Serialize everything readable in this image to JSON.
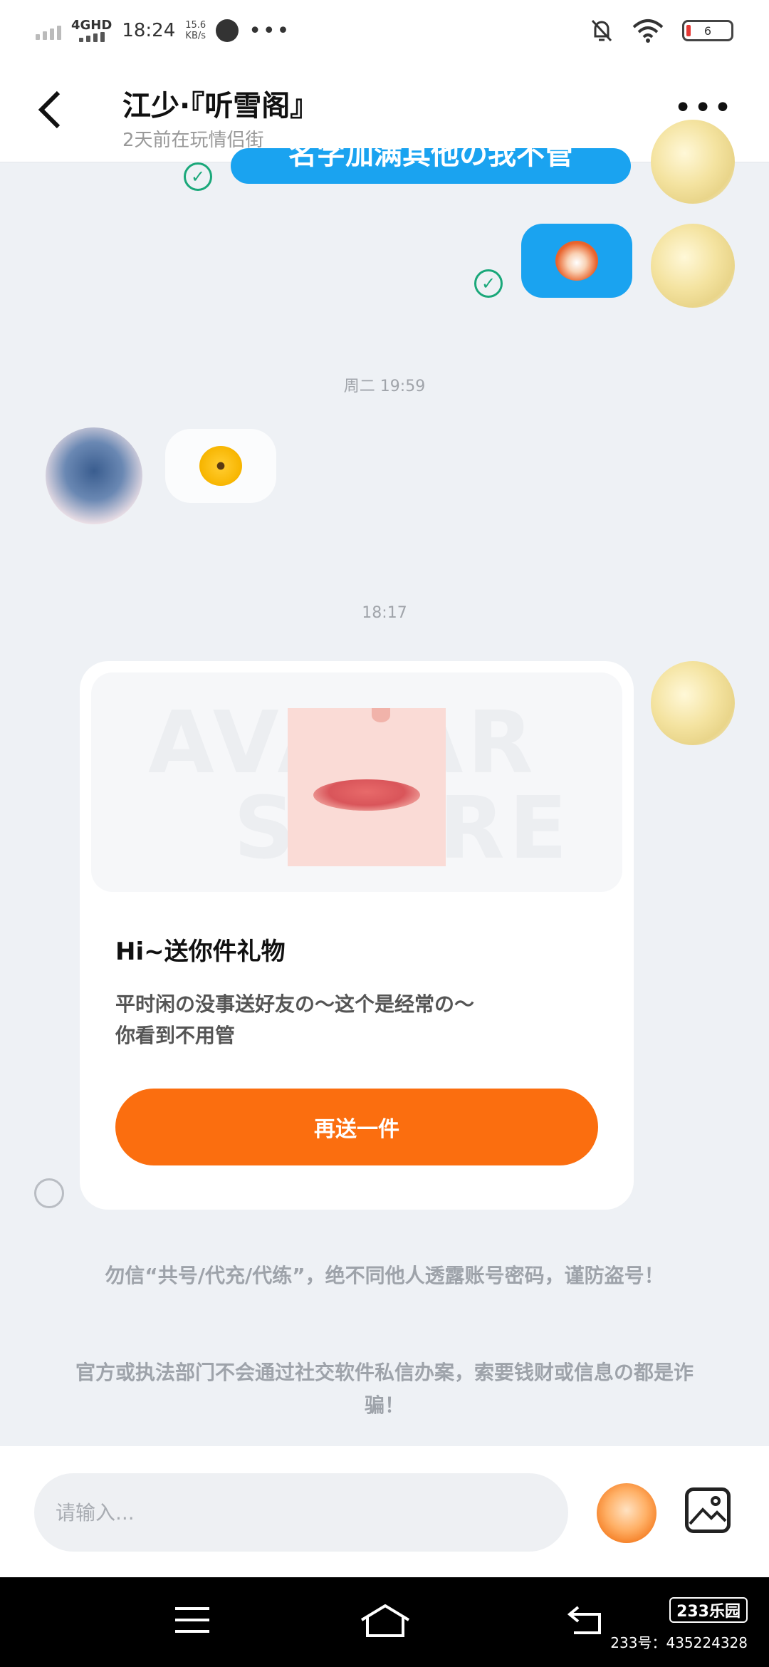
{
  "status_bar": {
    "network": "4GHD",
    "time": "18:24",
    "speed_value": "15.6",
    "speed_unit": "KB/s",
    "more": "•••",
    "battery": "6"
  },
  "header": {
    "title": "江少·『听雪阁』",
    "subtitle": "2天前在玩情侣街",
    "more": "•••"
  },
  "messages": {
    "top_partial_text": "名字加满其他の我不管",
    "date_divider": "周二 19:59",
    "time_divider": "18:17"
  },
  "gift_card": {
    "watermark_top": "AVATAR",
    "watermark_bottom": "STORE",
    "greeting": "Hi~送你件礼物",
    "desc_line1": "平时闲の没事送好友の～这个是经常の～",
    "desc_line2": "你看到不用管",
    "button_label": "再送一件"
  },
  "notices": {
    "notice1": "勿信“共号/代充/代练”，绝不同他人透露账号密码，谨防盗号！",
    "notice2": "官方或执法部门不会通过社交软件私信办案，索要钱财或信息の都是诈骗！"
  },
  "input": {
    "placeholder": "请输入..."
  },
  "navbar": {
    "brand": "233乐园",
    "brand_id": "233号：435224328"
  },
  "colors": {
    "accent_orange": "#fb6e0f",
    "bubble_blue": "#1aa3f0",
    "check_green": "#1aa87a"
  }
}
